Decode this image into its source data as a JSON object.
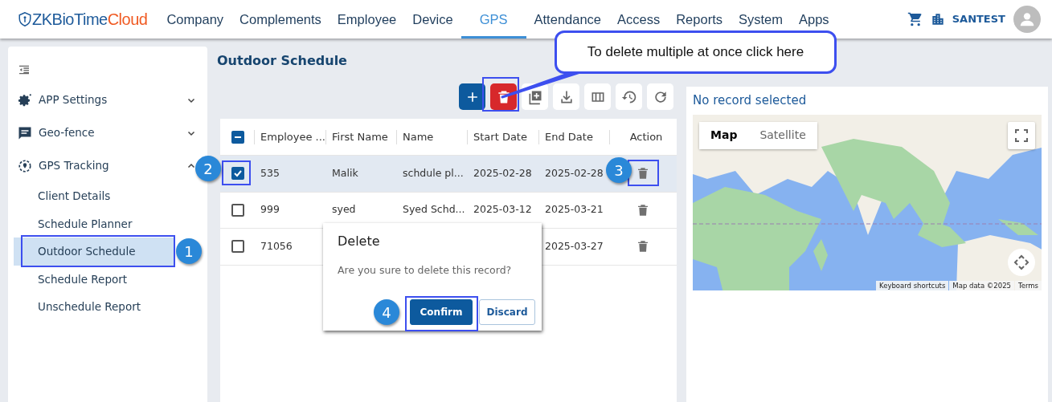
{
  "brand": {
    "name": "ZKBioTime",
    "accent": "Cloud"
  },
  "nav": [
    {
      "label": "Company",
      "selected": false
    },
    {
      "label": "Complements",
      "selected": false
    },
    {
      "label": "Employee",
      "selected": false
    },
    {
      "label": "Device",
      "selected": false
    },
    {
      "label": "GPS",
      "selected": true
    },
    {
      "label": "Attendance",
      "selected": false
    },
    {
      "label": "Access",
      "selected": false
    },
    {
      "label": "Reports",
      "selected": false
    },
    {
      "label": "System",
      "selected": false
    },
    {
      "label": "Apps",
      "selected": false
    }
  ],
  "user": {
    "company": "SANTEST"
  },
  "sidebar": {
    "items": [
      {
        "label": "APP Settings",
        "kind": "gear",
        "expanded": false
      },
      {
        "label": "Geo-fence",
        "kind": "chat",
        "expanded": false
      },
      {
        "label": "GPS Tracking",
        "kind": "location",
        "expanded": true,
        "children": [
          {
            "label": "Client Details",
            "selected": false
          },
          {
            "label": "Schedule Planner",
            "selected": false
          },
          {
            "label": "Outdoor Schedule",
            "selected": true
          },
          {
            "label": "Schedule Report",
            "selected": false
          },
          {
            "label": "Unschedule Report",
            "selected": false
          }
        ]
      }
    ]
  },
  "page": {
    "title": "Outdoor Schedule"
  },
  "toolbar": [
    {
      "kind": "add"
    },
    {
      "kind": "delete"
    },
    {
      "kind": "import"
    },
    {
      "kind": "export"
    },
    {
      "kind": "columns"
    },
    {
      "kind": "history"
    },
    {
      "kind": "refresh"
    }
  ],
  "table": {
    "columns": [
      "Employee ...",
      "First Name",
      "Name",
      "Start Date",
      "End Date",
      "Action"
    ],
    "partially_selected": true,
    "rows": [
      {
        "checked": true,
        "cells": [
          "535",
          "Malik",
          "schdule pl...",
          "2025-02-28",
          "2025-02-28"
        ]
      },
      {
        "checked": false,
        "cells": [
          "999",
          "syed",
          "Syed Schd...",
          "2025-03-12",
          "2025-03-21"
        ]
      },
      {
        "checked": false,
        "cells": [
          "71056",
          null,
          null,
          null,
          "2025-03-27"
        ]
      }
    ]
  },
  "details": {
    "title": "No record selected",
    "map_types": [
      {
        "label": "Map",
        "selected": true
      },
      {
        "label": "Satellite",
        "selected": false
      }
    ],
    "attribution": [
      "Keyboard shortcuts",
      "Map data ©2025",
      "Terms"
    ]
  },
  "dialog": {
    "title": "Delete",
    "message": "Are you sure to delete this record?",
    "buttons": [
      {
        "label": "Confirm",
        "kind": "primary"
      },
      {
        "label": "Discard",
        "kind": "outline"
      }
    ]
  },
  "annotations": {
    "callout": "To delete multiple at once click here",
    "steps": [
      "1",
      "2",
      "3",
      "4"
    ]
  }
}
